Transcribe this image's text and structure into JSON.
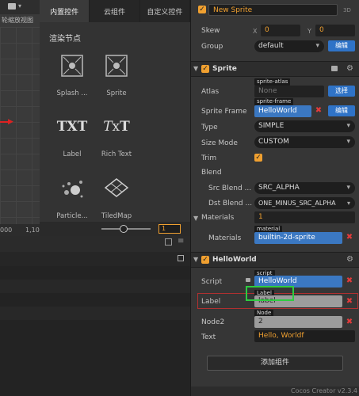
{
  "scene": {
    "hint": "轮缩放视图",
    "ruler_left": "000",
    "ruler_right": "1,10"
  },
  "library": {
    "tabs": [
      "内置控件",
      "云组件",
      "自定义控件"
    ],
    "section_title": "渲染节点",
    "items": [
      {
        "label": "Splash ...",
        "icon": "splash-icon"
      },
      {
        "label": "Sprite",
        "icon": "sprite-icon"
      },
      {
        "label": "Label",
        "icon": "label-txt-icon"
      },
      {
        "label": "Rich Text",
        "icon": "richtext-icon"
      },
      {
        "label": "Particle...",
        "icon": "particle-icon"
      },
      {
        "label": "TiledMap",
        "icon": "tiledmap-icon"
      }
    ],
    "zoom_value": "1"
  },
  "inspector": {
    "node_name": "New Sprite",
    "badge_3d": "3D",
    "skew": {
      "label": "Skew",
      "x_label": "X",
      "x": "0",
      "y_label": "Y",
      "y": "0"
    },
    "group": {
      "label": "Group",
      "value": "default",
      "edit": "编辑"
    },
    "sprite": {
      "title": "Sprite",
      "atlas_label": "Atlas",
      "atlas_tag": "sprite-atlas",
      "atlas_value": "None",
      "atlas_button": "选择",
      "frame_label": "Sprite Frame",
      "frame_tag": "sprite-frame",
      "frame_value": "HelloWorld",
      "frame_button": "编辑",
      "type_label": "Type",
      "type_value": "SIMPLE",
      "size_mode_label": "Size Mode",
      "size_mode_value": "CUSTOM",
      "trim_label": "Trim",
      "blend_label": "Blend",
      "src_blend_label": "Src Blend ...",
      "src_blend_value": "SRC_ALPHA",
      "dst_blend_label": "Dst Blend ...",
      "dst_blend_value": "ONE_MINUS_SRC_ALPHA",
      "materials_label": "Materials",
      "materials_count": "1",
      "material_label": "Materials",
      "material_tag": "material",
      "material_value": "builtin-2d-sprite"
    },
    "helloworld": {
      "title": "HelloWorld",
      "script_label": "Script",
      "script_tag": "script",
      "script_value": "HelloWorld",
      "label_label": "Label",
      "label_tag": "Label",
      "label_value": "label",
      "node2_label": "Node2",
      "node2_tag": "Node",
      "node2_value": "2",
      "text_label": "Text",
      "text_value": "Hello, Worldf"
    },
    "add_component": "添加组件",
    "footer": "Cocos Creator v2.3.4"
  },
  "colors": {
    "accent_orange": "#f0a030",
    "accent_blue": "#3b78c2",
    "highlight_green": "#2ecc40",
    "error_red": "#e23b3b"
  }
}
